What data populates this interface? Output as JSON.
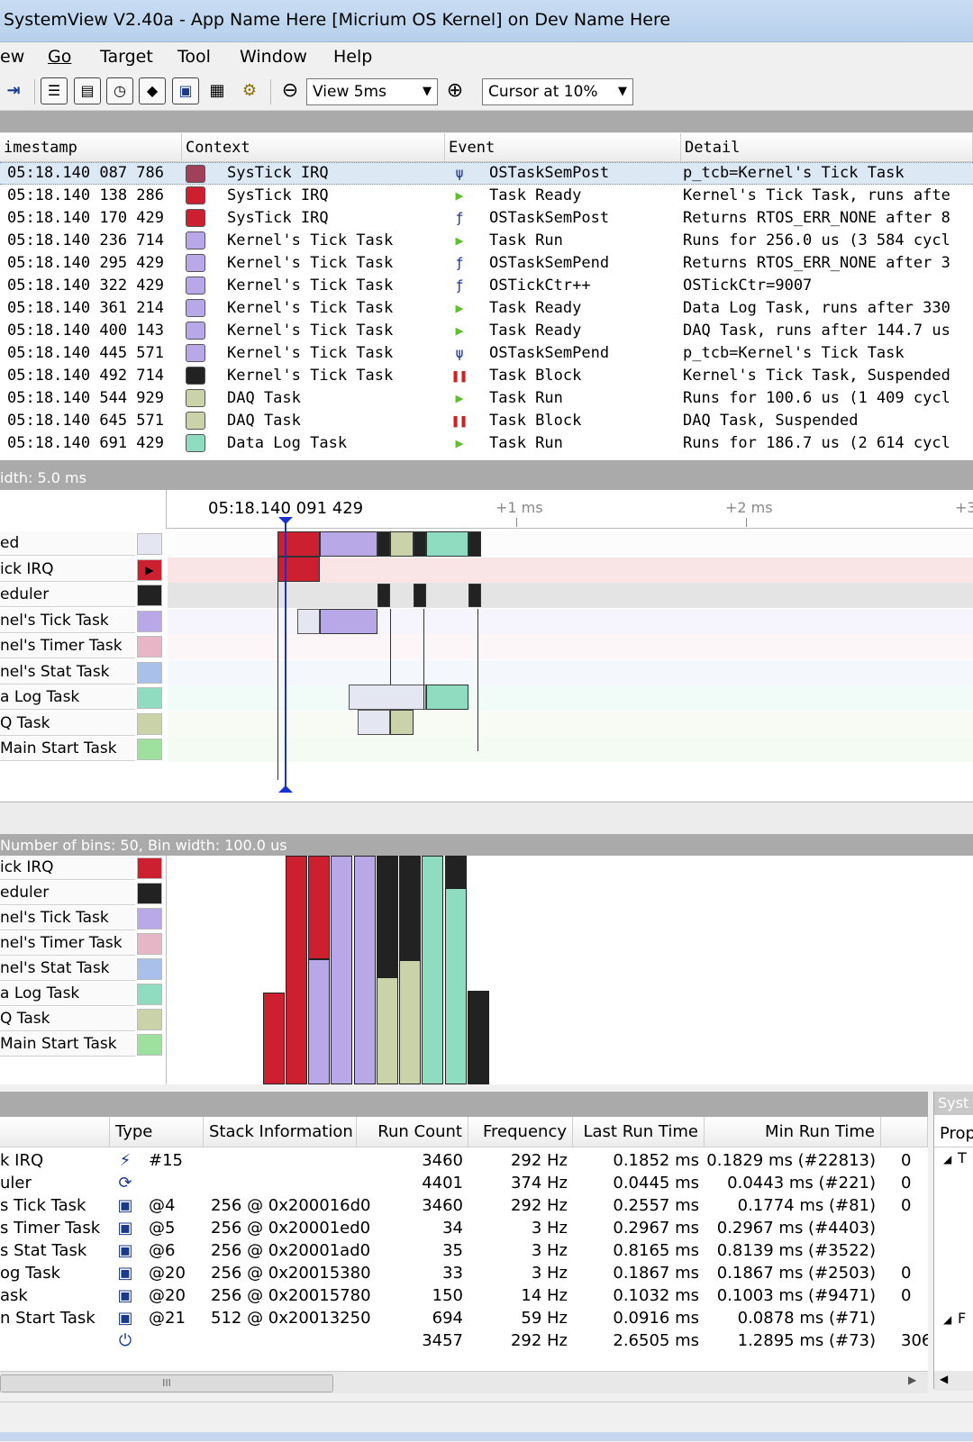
{
  "window": {
    "title": "SystemView V2.40a - App Name Here [Micrium OS Kernel] on Dev Name Here"
  },
  "menu": [
    "ew",
    "Go",
    "Target",
    "Tool",
    "Window",
    "Help"
  ],
  "toolbar": {
    "view_select": "View 5ms",
    "cursor_select": "Cursor at 10%"
  },
  "events": {
    "columns": [
      "imestamp",
      "Context",
      "Event",
      "Detail"
    ],
    "rows": [
      {
        "ts": "05:18.140 087 786",
        "ctx": "SysTick IRQ",
        "event": "OSTaskSemPost",
        "detail": "p_tcb=Kernel's Tick Task",
        "color": "#a0405a",
        "icon": "ψ"
      },
      {
        "ts": "05:18.140 138 286",
        "ctx": "SysTick IRQ",
        "event": "Task Ready",
        "detail": "Kernel's Tick Task, runs afte",
        "color": "#cc2030",
        "icon": "▶"
      },
      {
        "ts": "05:18.140 170 429",
        "ctx": "SysTick IRQ",
        "event": "OSTaskSemPost",
        "detail": "Returns RTOS_ERR_NONE after 8",
        "color": "#cc2030",
        "icon": "ƒ"
      },
      {
        "ts": "05:18.140 236 714",
        "ctx": "Kernel's Tick Task",
        "event": "Task Run",
        "detail": "Runs for 256.0 us (3 584 cycl",
        "color": "#b9a8e8",
        "icon": "▶"
      },
      {
        "ts": "05:18.140 295 429",
        "ctx": "Kernel's Tick Task",
        "event": "OSTaskSemPend",
        "detail": "Returns RTOS_ERR_NONE after 3",
        "color": "#b9a8e8",
        "icon": "ƒ"
      },
      {
        "ts": "05:18.140 322 429",
        "ctx": "Kernel's Tick Task",
        "event": "OSTickCtr++",
        "detail": "OSTickCtr=9007",
        "color": "#b9a8e8",
        "icon": "ƒ"
      },
      {
        "ts": "05:18.140 361 214",
        "ctx": "Kernel's Tick Task",
        "event": "Task Ready",
        "detail": "Data Log Task, runs after 330",
        "color": "#b9a8e8",
        "icon": "▶"
      },
      {
        "ts": "05:18.140 400 143",
        "ctx": "Kernel's Tick Task",
        "event": "Task Ready",
        "detail": "DAQ Task, runs after 144.7 us",
        "color": "#b9a8e8",
        "icon": "▶"
      },
      {
        "ts": "05:18.140 445 571",
        "ctx": "Kernel's Tick Task",
        "event": "OSTaskSemPend",
        "detail": "p_tcb=Kernel's Tick Task",
        "color": "#b9a8e8",
        "icon": "ψ"
      },
      {
        "ts": "05:18.140 492 714",
        "ctx": "Kernel's Tick Task",
        "event": "Task Block",
        "detail": "Kernel's Tick Task, Suspended",
        "color": "#222222",
        "icon": "❚❚"
      },
      {
        "ts": "05:18.140 544 929",
        "ctx": "DAQ Task",
        "event": "Task Run",
        "detail": "Runs for 100.6 us (1 409 cycl",
        "color": "#c9d2a8",
        "icon": "▶"
      },
      {
        "ts": "05:18.140 645 571",
        "ctx": "DAQ Task",
        "event": "Task Block",
        "detail": "DAQ Task, Suspended",
        "color": "#c9d2a8",
        "icon": "❚❚"
      },
      {
        "ts": "05:18.140 691 429",
        "ctx": "Data Log Task",
        "event": "Task Run",
        "detail": "Runs for 186.7 us (2 614 cycl",
        "color": "#8fdcc0",
        "icon": "▶"
      }
    ]
  },
  "timeline": {
    "width_label": "idth:  5.0 ms",
    "cursor_time": "05:18.140 091 429",
    "ticks": [
      "+1 ms",
      "+2 ms",
      "+3"
    ],
    "lanes": [
      {
        "label": "ed",
        "color": "#e4e6f2"
      },
      {
        "label": "ick IRQ",
        "color": "#cc2030"
      },
      {
        "label": "eduler",
        "color": "#222222"
      },
      {
        "label": "nel's Tick Task",
        "color": "#b9a8e8"
      },
      {
        "label": "nel's Timer Task",
        "color": "#e6b5c6"
      },
      {
        "label": "nel's Stat Task",
        "color": "#a8c0ea"
      },
      {
        "label": "a Log Task",
        "color": "#8fdcc0"
      },
      {
        "label": "Q Task",
        "color": "#c9d2a8"
      },
      {
        "label": "Main Start Task",
        "color": "#9ee09e"
      }
    ]
  },
  "histogram": {
    "label": "Number of bins: 50, Bin width: 100.0 us",
    "lanes": [
      {
        "label": "ick IRQ",
        "color": "#cc2030"
      },
      {
        "label": "eduler",
        "color": "#222222"
      },
      {
        "label": "nel's Tick Task",
        "color": "#b9a8e8"
      },
      {
        "label": "nel's Timer Task",
        "color": "#e6b5c6"
      },
      {
        "label": "nel's Stat Task",
        "color": "#a8c0ea"
      },
      {
        "label": "a Log Task",
        "color": "#8fdcc0"
      },
      {
        "label": "Q Task",
        "color": "#c9d2a8"
      },
      {
        "label": "Main Start Task",
        "color": "#9ee09e"
      }
    ]
  },
  "tasks": {
    "columns": [
      "Type",
      "Stack Information",
      "Run Count",
      "Frequency",
      "Last Run Time",
      "Min Run Time"
    ],
    "rows": [
      {
        "name": "k IRQ",
        "icon": "⚡",
        "type": "#15",
        "stack": "",
        "count": "3460",
        "freq": "292 Hz",
        "last": "0.1852 ms",
        "min": "0.1829 ms (#22813)",
        "extra": "0"
      },
      {
        "name": "uler",
        "icon": "⟳",
        "type": "",
        "stack": "",
        "count": "4401",
        "freq": "374 Hz",
        "last": "0.0445 ms",
        "min": "0.0443 ms (#221)",
        "extra": "0"
      },
      {
        "name": "s Tick Task",
        "icon": "▣",
        "type": "@4",
        "stack": "256 @ 0x200016d0",
        "count": "3460",
        "freq": "292 Hz",
        "last": "0.2557 ms",
        "min": "0.1774 ms (#81)",
        "extra": "0"
      },
      {
        "name": "s Timer Task",
        "icon": "▣",
        "type": "@5",
        "stack": "256 @ 0x20001ed0",
        "count": "34",
        "freq": "3 Hz",
        "last": "0.2967 ms",
        "min": "0.2967 ms (#4403)",
        "extra": ""
      },
      {
        "name": "s Stat Task",
        "icon": "▣",
        "type": "@6",
        "stack": "256 @ 0x20001ad0",
        "count": "35",
        "freq": "3 Hz",
        "last": "0.8165 ms",
        "min": "0.8139 ms (#3522)",
        "extra": ""
      },
      {
        "name": "og Task",
        "icon": "▣",
        "type": "@20",
        "stack": "256 @ 0x20015380",
        "count": "33",
        "freq": "3 Hz",
        "last": "0.1867 ms",
        "min": "0.1867 ms (#2503)",
        "extra": "0"
      },
      {
        "name": "ask",
        "icon": "▣",
        "type": "@20",
        "stack": "256 @ 0x20015780",
        "count": "150",
        "freq": "14 Hz",
        "last": "0.1032 ms",
        "min": "0.1003 ms (#9471)",
        "extra": "0"
      },
      {
        "name": "n Start Task",
        "icon": "▣",
        "type": "@21",
        "stack": "512 @ 0x20013250",
        "count": "694",
        "freq": "59 Hz",
        "last": "0.0916 ms",
        "min": "0.0878 ms (#71)",
        "extra": ""
      },
      {
        "name": "",
        "icon": "⏻",
        "type": "",
        "stack": "",
        "count": "3457",
        "freq": "292 Hz",
        "last": "2.6505 ms",
        "min": "1.2895 ms (#73)",
        "extra": "306"
      }
    ]
  },
  "props": {
    "title": "Syst",
    "header": "Prop"
  },
  "scrollbar": {
    "thumb_label": "III"
  }
}
